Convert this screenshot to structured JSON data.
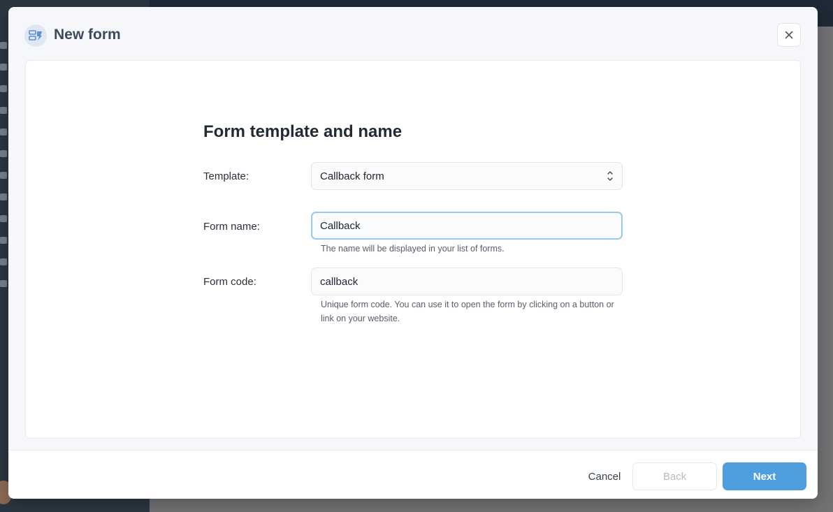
{
  "modal": {
    "title": "New form",
    "header_icon": "form-icon",
    "close_icon": "close-icon"
  },
  "form": {
    "section_title": "Form template and name",
    "template": {
      "label": "Template:",
      "value": "Callback form"
    },
    "name": {
      "label": "Form name:",
      "value": "Callback",
      "hint": "The name will be displayed in your list of forms."
    },
    "code": {
      "label": "Form code:",
      "value": "callback",
      "hint": "Unique form code. You can use it to open the form by clicking on a button or link on your website."
    }
  },
  "footer": {
    "cancel_label": "Cancel",
    "back_label": "Back",
    "next_label": "Next"
  },
  "colors": {
    "accent": "#4f9fdf",
    "focus_border": "#9ac9ea"
  }
}
